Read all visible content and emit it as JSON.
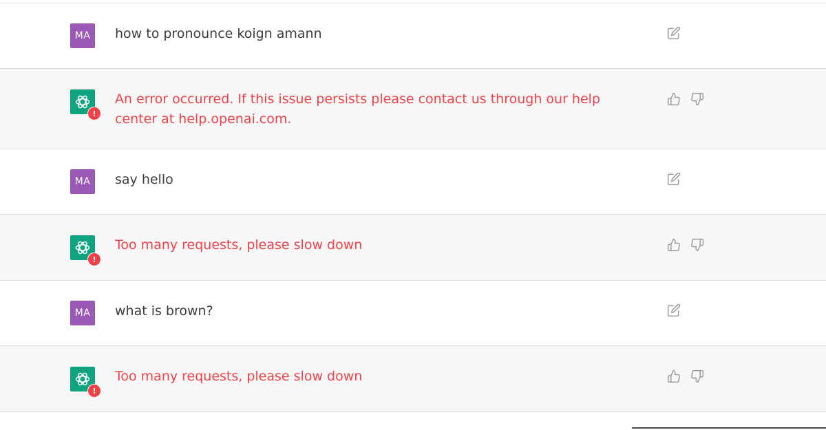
{
  "messages": [
    {
      "role": "user",
      "avatar_initials": "MA",
      "text": "how to pronounce koign amann"
    },
    {
      "role": "assistant",
      "error_badge": "!",
      "text": "An error occurred. If this issue persists please contact us through our help center at help.openai.com."
    },
    {
      "role": "user",
      "avatar_initials": "MA",
      "text": "say hello"
    },
    {
      "role": "assistant",
      "error_badge": "!",
      "text": "Too many requests, please slow down"
    },
    {
      "role": "user",
      "avatar_initials": "MA",
      "text": "what is brown?"
    },
    {
      "role": "assistant",
      "error_badge": "!",
      "text": "Too many requests, please slow down"
    }
  ],
  "icons": {
    "user_action": "edit-icon",
    "assistant_actions": [
      "thumbs-up-icon",
      "thumbs-down-icon"
    ]
  },
  "colors": {
    "user_avatar": "#9b59b6",
    "assistant_avatar": "#10a37f",
    "error_text": "#ef4146",
    "assistant_row_bg": "#f7f7f8"
  }
}
